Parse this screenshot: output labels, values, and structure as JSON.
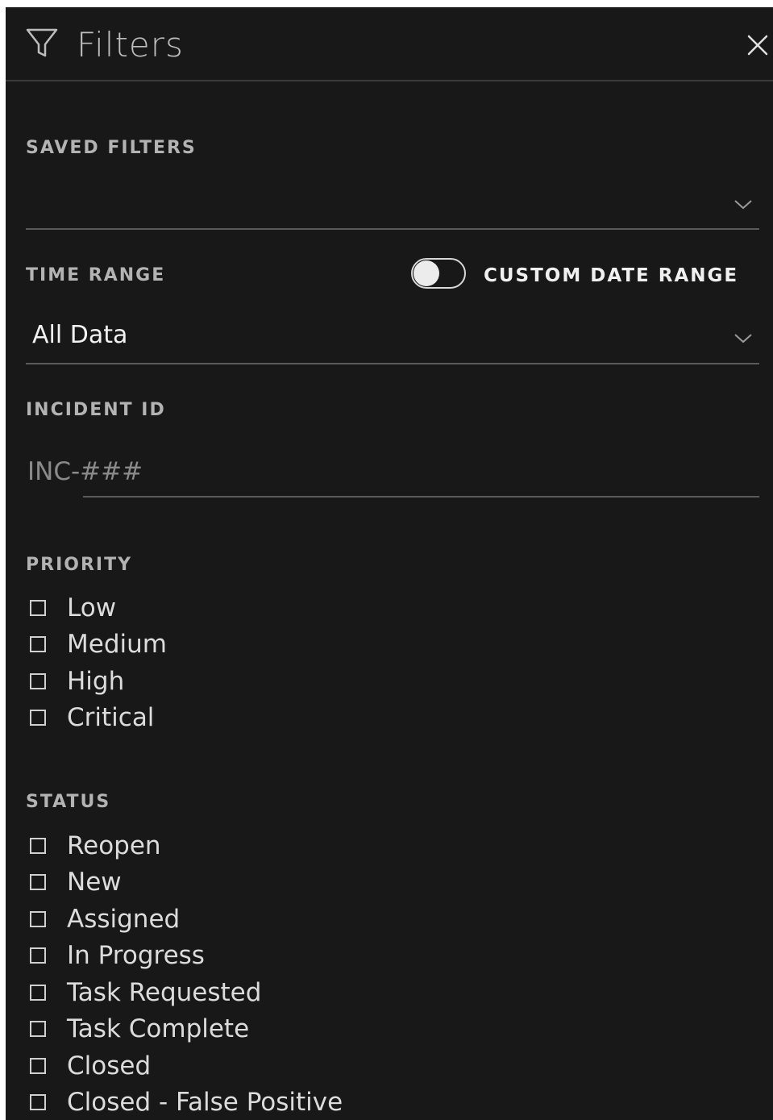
{
  "panel": {
    "title": "Filters",
    "icons": {
      "filter": "funnel-icon",
      "close": "close-icon"
    }
  },
  "saved_filters": {
    "label": "SAVED FILTERS",
    "value": ""
  },
  "time_range": {
    "label": "TIME RANGE",
    "value": "All Data",
    "toggle_label": "CUSTOM DATE RANGE",
    "toggle_on": false
  },
  "incident_id": {
    "label": "INCIDENT ID",
    "placeholder": "INC-###",
    "value": ""
  },
  "priority": {
    "label": "PRIORITY",
    "options": [
      "Low",
      "Medium",
      "High",
      "Critical"
    ]
  },
  "status": {
    "label": "STATUS",
    "options": [
      "Reopen",
      "New",
      "Assigned",
      "In Progress",
      "Task Requested",
      "Task Complete",
      "Closed",
      "Closed - False Positive"
    ]
  },
  "colors": {
    "background": "#181818",
    "text": "#dcdcdc",
    "label": "#b3b3b3",
    "divider": "#5a5a5a"
  }
}
